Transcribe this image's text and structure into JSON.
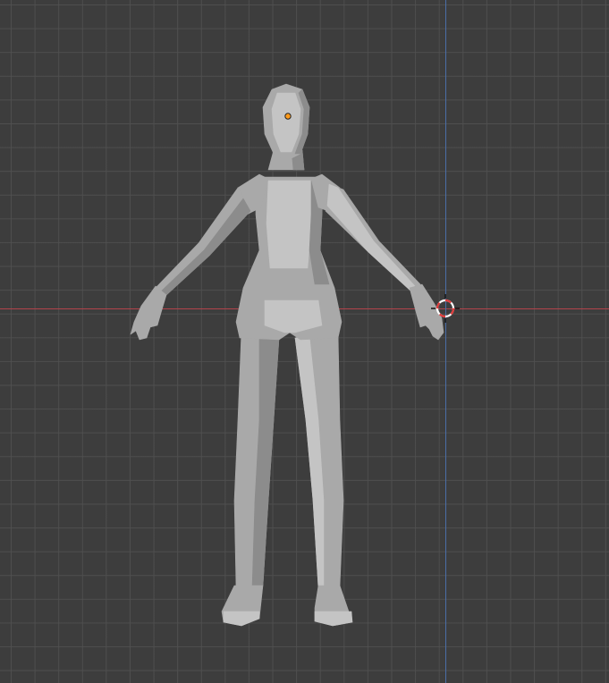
{
  "viewport": {
    "background_color": "#3d3d3d",
    "grid_color": "#505050",
    "x_axis_color": "#b3434b",
    "z_axis_color": "#4a6ea8"
  },
  "model": {
    "name_icon": "humanoid-mesh",
    "base_color": "#a9a9a9",
    "shade_dark": "#8c8c8c",
    "shade_light": "#c4c4c4",
    "origin_color": "#ff9a1a"
  },
  "cursor_3d": {
    "icon": "3d-cursor-icon",
    "ring_color_a": "#ffffff",
    "ring_color_b": "#e03a3a"
  }
}
